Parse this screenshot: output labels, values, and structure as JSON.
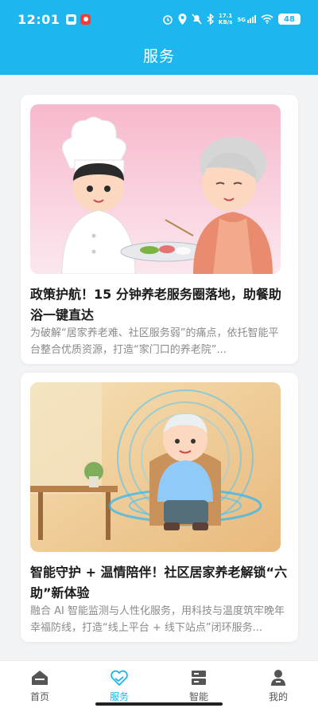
{
  "status_bar": {
    "time": "12:01",
    "net_speed_value": "17.1",
    "net_speed_unit": "KB/s",
    "network": "5G",
    "battery": "48"
  },
  "header": {
    "title": "服务"
  },
  "articles": [
    {
      "title": "政策护航！15 分钟养老服务圈落地，助餐助浴一键直达",
      "summary": "为破解“居家养老难、社区服务弱”的痛点，依托智能平台整合优质资源，打造“家门口的养老院”..."
    },
    {
      "title": "智能守护 + 温情陪伴！社区居家养老解锁“六助”新体验",
      "summary": "融合 AI 智能监测与人性化服务，用科技与温度筑牢晚年幸福防线，打造“线上平台 + 线下站点”闭环服务..."
    }
  ],
  "tabbar": {
    "items": [
      {
        "label": "首页",
        "icon": "home-icon"
      },
      {
        "label": "服务",
        "icon": "heart-hands-icon"
      },
      {
        "label": "智能",
        "icon": "server-icon"
      },
      {
        "label": "我的",
        "icon": "person-icon"
      }
    ],
    "active_index": 1
  },
  "colors": {
    "accent": "#1eb6ef",
    "tab_inactive": "#555555"
  }
}
